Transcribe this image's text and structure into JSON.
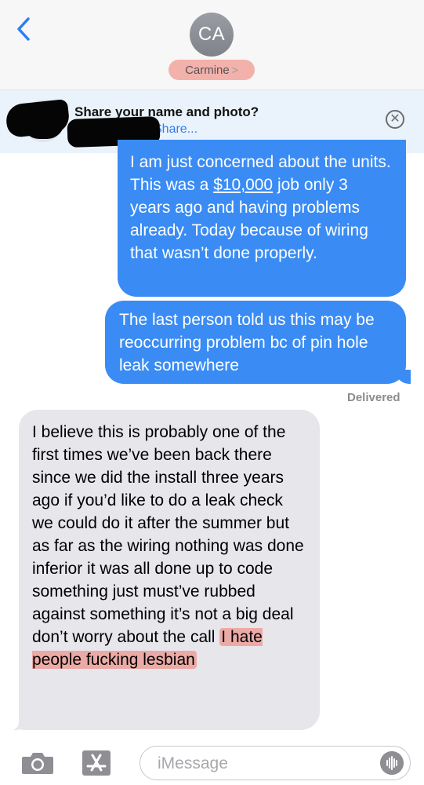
{
  "header": {
    "avatar_initials": "CA",
    "contact_name": "Carmine",
    "contact_chevron": ">"
  },
  "share_banner": {
    "title": "Share your name and photo?",
    "link": "Share..."
  },
  "messages": [
    {
      "direction": "outgoing",
      "parts": [
        "I am just concerned about the units. This was a ",
        "$10,000",
        " job only 3 years ago and having problems already. Today because of wiring that wasn’t done properly."
      ]
    },
    {
      "direction": "outgoing",
      "text": "The last person told us this may be reoccurring problem bc of pin hole leak somewhere"
    },
    {
      "direction": "incoming",
      "text": "I believe this is probably one of the first times we’ve been back there since we did the install three years ago if you’d like to do a leak check we could do it after the summer but as far as the wiring nothing was done inferior it was all done up to code something just must’ve rubbed against something it’s not a big deal don’t worry about the call ",
      "highlighted": "I hate people fucking lesbian"
    }
  ],
  "delivered_label": "Delivered",
  "composer": {
    "placeholder": "iMessage"
  },
  "colors": {
    "outgoing_bubble": "#3a8cf4",
    "incoming_bubble": "#e6e6eb",
    "highlight": "#f0786e",
    "link": "#2f7cf6"
  },
  "icons": [
    "back-chevron-icon",
    "close-circle-icon",
    "camera-icon",
    "app-store-icon",
    "audio-waveform-icon"
  ]
}
